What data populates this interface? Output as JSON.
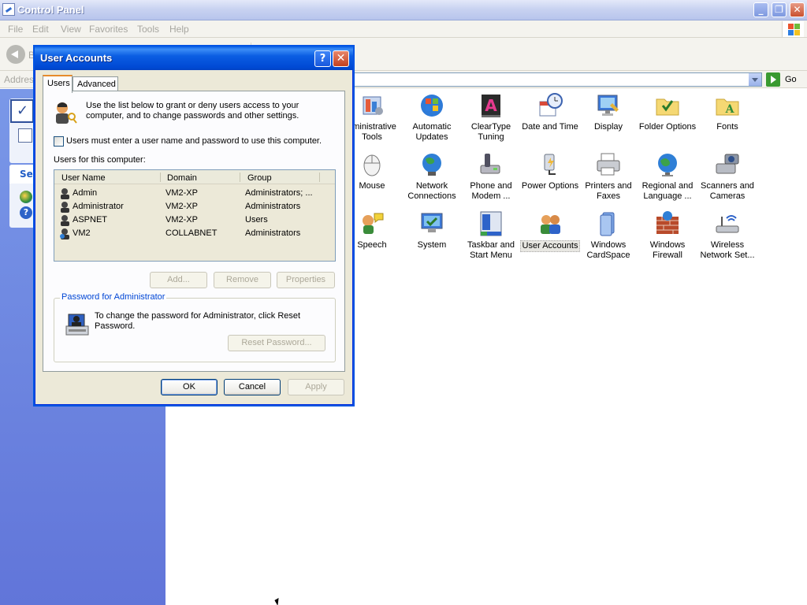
{
  "window": {
    "title": "Control Panel",
    "minimize": "_",
    "maximize": "❐",
    "close": "✕"
  },
  "menu": [
    "File",
    "Edit",
    "View",
    "Favorites",
    "Tools",
    "Help"
  ],
  "toolbar": {
    "back_partial": "B"
  },
  "address": {
    "label": "Address",
    "go_label": "Go"
  },
  "leftpane": {
    "see_also_partial": "See"
  },
  "icons": [
    {
      "label": "dministrative Tools",
      "icon": "administrative-tools-icon"
    },
    {
      "label": "Automatic Updates",
      "icon": "automatic-updates-icon"
    },
    {
      "label": "ClearType Tuning",
      "icon": "cleartype-icon"
    },
    {
      "label": "Date and Time",
      "icon": "date-time-icon"
    },
    {
      "label": "Display",
      "icon": "display-icon"
    },
    {
      "label": "Folder Options",
      "icon": "folder-options-icon"
    },
    {
      "label": "Fonts",
      "icon": "fonts-icon"
    },
    {
      "label": "Mouse",
      "icon": "mouse-icon"
    },
    {
      "label": "Network Connections",
      "icon": "network-icon"
    },
    {
      "label": "Phone and Modem ...",
      "icon": "phone-modem-icon"
    },
    {
      "label": "Power Options",
      "icon": "power-options-icon"
    },
    {
      "label": "Printers and Faxes",
      "icon": "printer-icon"
    },
    {
      "label": "Regional and Language ...",
      "icon": "globe-icon"
    },
    {
      "label": "Scanners and Cameras",
      "icon": "scanner-icon"
    },
    {
      "label": "Speech",
      "icon": "speech-icon"
    },
    {
      "label": "System",
      "icon": "system-icon"
    },
    {
      "label": "Taskbar and Start Menu",
      "icon": "taskbar-icon"
    },
    {
      "label": "User Accounts",
      "icon": "user-accounts-icon"
    },
    {
      "label": "Windows CardSpace",
      "icon": "cardspace-icon"
    },
    {
      "label": "Windows Firewall",
      "icon": "firewall-icon"
    },
    {
      "label": "Wireless Network Set...",
      "icon": "wireless-icon"
    }
  ],
  "dialog": {
    "title": "User Accounts",
    "help_glyph": "?",
    "close_glyph": "✕",
    "tabs": [
      "Users",
      "Advanced"
    ],
    "intro": "Use the list below to grant or deny users access to your computer, and to change passwords and other settings.",
    "require_login_label": "Users must enter a user name and password to use this computer.",
    "require_login_checked": false,
    "users_label": "Users for this computer:",
    "columns": [
      "User Name",
      "Domain",
      "Group"
    ],
    "users": [
      {
        "name": "Admin",
        "domain": "VM2-XP",
        "group": "Administrators; ..."
      },
      {
        "name": "Administrator",
        "domain": "VM2-XP",
        "group": "Administrators"
      },
      {
        "name": "ASPNET",
        "domain": "VM2-XP",
        "group": "Users"
      },
      {
        "name": "VM2",
        "domain": "COLLABNET",
        "group": "Administrators"
      }
    ],
    "buttons": {
      "add": "Add...",
      "remove": "Remove",
      "properties": "Properties"
    },
    "password_group_title": "Password for Administrator",
    "password_text": "To change the password for Administrator, click Reset Password.",
    "reset_password": "Reset Password...",
    "ok": "OK",
    "cancel": "Cancel",
    "apply": "Apply"
  }
}
